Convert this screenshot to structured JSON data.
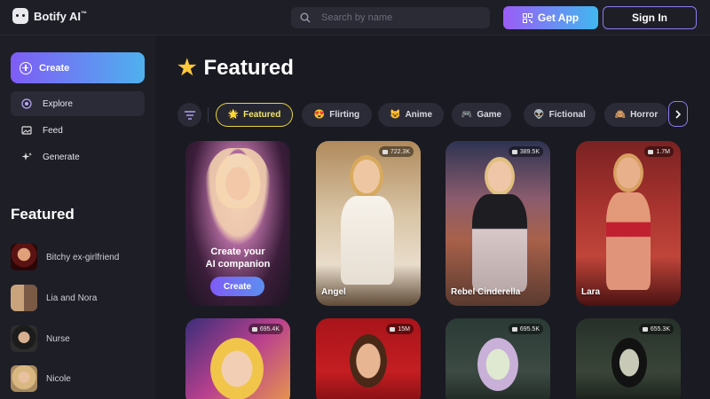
{
  "header": {
    "brand": "Botify AI",
    "brand_mark": "™",
    "search_placeholder": "Search by name",
    "get_app_label": "Get App",
    "sign_in_label": "Sign In"
  },
  "sidebar": {
    "create_label": "Create",
    "nav": [
      {
        "label": "Explore",
        "icon": "explore-icon",
        "active": true
      },
      {
        "label": "Feed",
        "icon": "feed-icon",
        "active": false
      },
      {
        "label": "Generate",
        "icon": "sparkle-icon",
        "active": false
      }
    ],
    "featured_title": "Featured",
    "characters": [
      {
        "name": "Bitchy ex-girlfriend"
      },
      {
        "name": "Lia and Nora"
      },
      {
        "name": "Nurse"
      },
      {
        "name": "Nicole"
      }
    ]
  },
  "main": {
    "title": "Featured",
    "title_icon": "star-icon",
    "chips": [
      {
        "emoji": "🌟",
        "label": "Featured",
        "active": true
      },
      {
        "emoji": "😍",
        "label": "Flirting",
        "active": false
      },
      {
        "emoji": "😺",
        "label": "Anime",
        "active": false
      },
      {
        "emoji": "🎮",
        "label": "Game",
        "active": false
      },
      {
        "emoji": "👽",
        "label": "Fictional",
        "active": false
      },
      {
        "emoji": "🙈",
        "label": "Horror",
        "active": false
      }
    ],
    "create_card": {
      "line1": "Create your",
      "line2": "AI companion",
      "button": "Create"
    },
    "cards": [
      {
        "name": "Angel",
        "count": "722.3K"
      },
      {
        "name": "Rebel Cinderella",
        "count": "389.5K"
      },
      {
        "name": "Lara",
        "count": "1.7M"
      },
      {
        "name": "",
        "count": "695.4K"
      },
      {
        "name": "",
        "count": "15M"
      },
      {
        "name": "",
        "count": "695.5K"
      },
      {
        "name": "",
        "count": "655.3K"
      }
    ]
  },
  "colors": {
    "background": "#1a1a22",
    "panel": "#1e1e27",
    "accent_purple": "#8b7cf0",
    "accent_yellow": "#e8d43a"
  }
}
